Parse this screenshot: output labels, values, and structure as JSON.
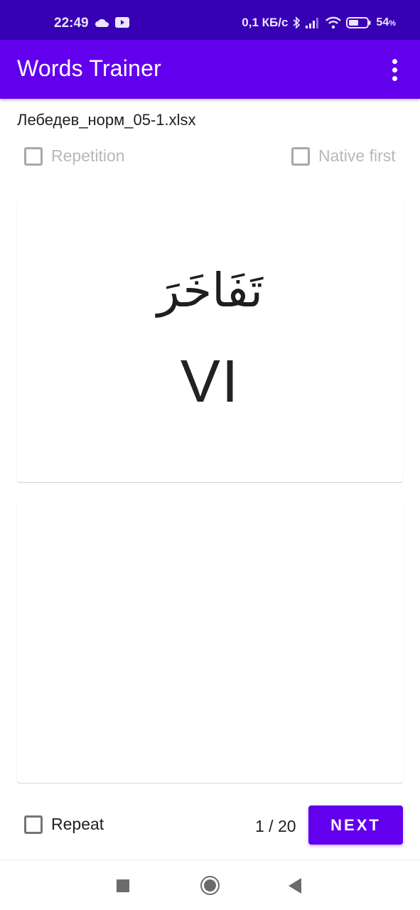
{
  "status_bar": {
    "time": "22:49",
    "left_icons": [
      "cloud-icon",
      "youtube-icon"
    ],
    "network_speed": "0,1 КБ/с",
    "right_icons": [
      "bluetooth-icon",
      "signal-icon",
      "wifi-icon",
      "battery-icon"
    ],
    "battery_percent": "54",
    "battery_unit": "%"
  },
  "app_bar": {
    "title": "Words Trainer",
    "menu_icon": "more-vert-icon"
  },
  "file": {
    "name": "Лебедев_норм_05-1.xlsx"
  },
  "options": {
    "repetition": {
      "label": "Repetition",
      "checked": false,
      "enabled": false
    },
    "native_first": {
      "label": "Native first",
      "checked": false,
      "enabled": false
    }
  },
  "question_card": {
    "word": "تَفَاخَرَ",
    "form": "VI"
  },
  "answer_card": {
    "text": ""
  },
  "footer": {
    "repeat": {
      "label": "Repeat",
      "checked": false
    },
    "counter": "1 / 20",
    "next_label": "NEXT"
  },
  "colors": {
    "primary": "#6200ee",
    "primary_dark": "#3700b3"
  },
  "nav_bar": {
    "buttons": [
      "recents-icon",
      "home-icon",
      "back-icon"
    ]
  }
}
